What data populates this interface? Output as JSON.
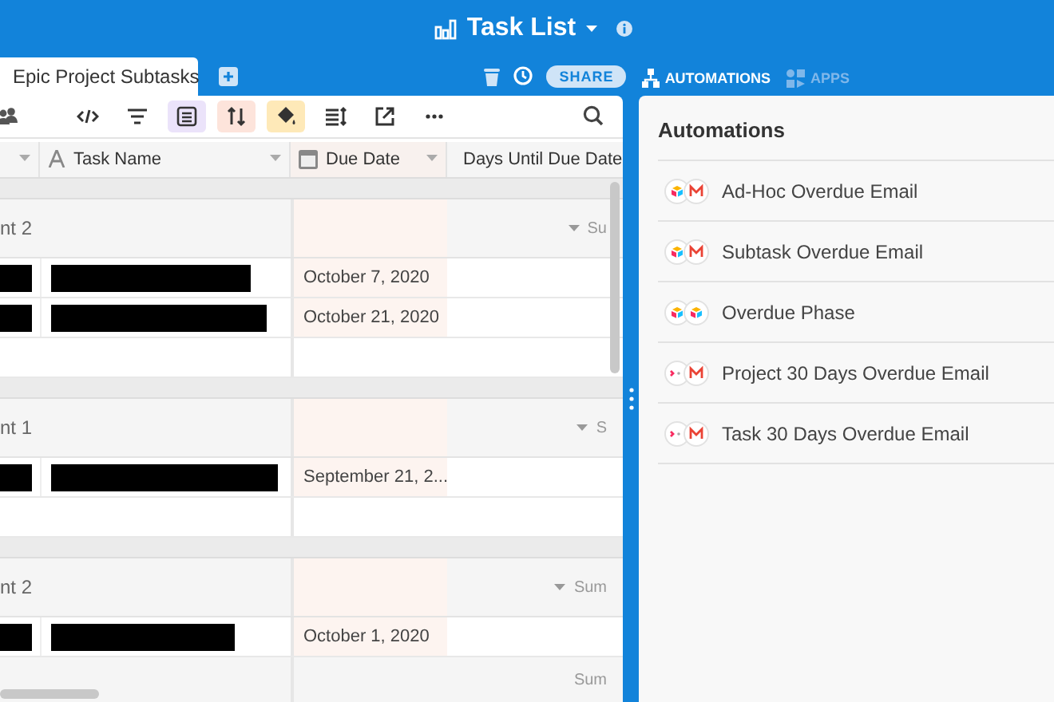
{
  "header": {
    "title": "Task List"
  },
  "table_tab": {
    "label": "Epic Project Subtasks"
  },
  "share": "SHARE",
  "view_tabs": [
    {
      "label": "AUTOMATIONS",
      "selected": true,
      "kind": "automations"
    },
    {
      "label": "APPS",
      "selected": false,
      "kind": "apps"
    }
  ],
  "toolbar": [
    {
      "kind": "people"
    },
    {
      "kind": "code"
    },
    {
      "kind": "filter"
    },
    {
      "kind": "group",
      "color": "#ebe3fa"
    },
    {
      "kind": "sort",
      "color": "#fde4db"
    },
    {
      "kind": "paint",
      "color": "#fee9b8"
    },
    {
      "kind": "height"
    },
    {
      "kind": "export"
    },
    {
      "kind": "more"
    }
  ],
  "columns": [
    {
      "kind": "text",
      "label": "Task Name"
    },
    {
      "kind": "date",
      "label": "Due Date"
    },
    {
      "kind": "formula",
      "label": "Days Until Due Date"
    }
  ],
  "groups": [
    {
      "label": "nt 2",
      "summary": "Su",
      "rows": [
        {
          "due": "October 7, 2020"
        },
        {
          "due": "October 21, 2020"
        }
      ]
    },
    {
      "label": "nt 1",
      "summary": "S",
      "rows": [
        {
          "due": "September 21, 2..."
        }
      ]
    },
    {
      "label": "nt 2",
      "summary": "Sum",
      "rows": [
        {
          "due": "October 1, 2020"
        }
      ]
    }
  ],
  "footer": "Sum",
  "automations": {
    "title": "Automations",
    "items": [
      {
        "name": "Ad-Hoc Overdue Email",
        "icons": [
          {
            "kind": "blocks"
          },
          {
            "kind": "mail"
          }
        ]
      },
      {
        "name": "Subtask Overdue Email",
        "icons": [
          {
            "kind": "blocks"
          },
          {
            "kind": "mail"
          }
        ]
      },
      {
        "name": "Overdue Phase",
        "icons": [
          {
            "kind": "blocks"
          },
          {
            "kind": "blocks"
          }
        ]
      },
      {
        "name": "Project 30 Days Overdue Email",
        "icons": [
          {
            "kind": "partial"
          },
          {
            "kind": "mail"
          }
        ]
      },
      {
        "name": "Task 30 Days Overdue Email",
        "icons": [
          {
            "kind": "partial"
          },
          {
            "kind": "mail"
          }
        ]
      }
    ]
  }
}
